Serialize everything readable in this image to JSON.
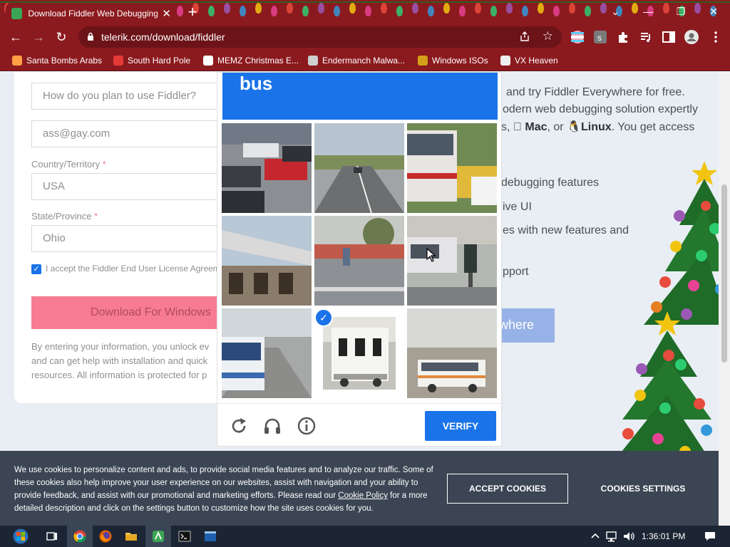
{
  "browser": {
    "tab_title": "Download Fiddler Web Debugging Proxy",
    "tab_close": "✕",
    "new_tab": "+",
    "url": "telerik.com/download/fiddler",
    "window_controls": [
      "⌄",
      "—",
      "❐",
      "✕"
    ],
    "nav": {
      "back": "←",
      "forward": "→",
      "reload": "↻"
    }
  },
  "bookmarks": [
    {
      "label": "Santa Bombs Arabs",
      "color": "#ff9f43"
    },
    {
      "label": "South Hard Pole",
      "color": "#e53935"
    },
    {
      "label": "MEMZ Christmas E...",
      "color": "#ffffff"
    },
    {
      "label": "Endermanch Malwa...",
      "color": "#cfcfcf"
    },
    {
      "label": "Windows ISOs",
      "color": "#d4a017"
    },
    {
      "label": "VX Heaven",
      "color": "#eeeeee"
    }
  ],
  "form": {
    "usage_placeholder": "How do you plan to use Fiddler?",
    "email_value": "ass@gay.com",
    "country_label": "Country/Territory",
    "country_value": "USA",
    "state_label": "State/Province",
    "state_value": "Ohio",
    "required_mark": "*",
    "eula_label": "I accept the Fiddler End User License Agreement",
    "download_button": "Download For Windows",
    "disclaimer": [
      "By entering your information, you unlock ev",
      "and can get help with installation and quick",
      "resources. All information is protected for p"
    ]
  },
  "promo": {
    "line1": "and try Fiddler Everywhere for free.",
    "line2": "odern web debugging solution expertly",
    "line3_pre": "s,",
    "mac": "Mac",
    "line3_mid": ", or",
    "linux": "Linux",
    "line3_post": ". You get access",
    "bullet1": "debugging features",
    "bullet2": "ive UI",
    "bullet3": "es with new features and",
    "bullet4": "pport",
    "button": "where"
  },
  "captcha": {
    "prompt_word": "bus",
    "tiles": [
      {
        "id": "tile-1",
        "selected": false
      },
      {
        "id": "tile-2",
        "selected": false
      },
      {
        "id": "tile-3",
        "selected": false
      },
      {
        "id": "tile-4",
        "selected": false
      },
      {
        "id": "tile-5",
        "selected": false
      },
      {
        "id": "tile-6",
        "selected": false
      },
      {
        "id": "tile-7",
        "selected": false
      },
      {
        "id": "tile-8",
        "selected": true
      },
      {
        "id": "tile-9",
        "selected": false
      }
    ],
    "verify_label": "VERIFY",
    "check_mark": "✓"
  },
  "cookie": {
    "text_before_link": "We use cookies to personalize content and ads, to provide social media features and to analyze our traffic. Some of these cookies also help improve your user experience on our websites, assist with navigation and your ability to provide feedback, and assist with our promotional and marketing efforts. Please read our ",
    "link": "Cookie Policy",
    "text_after_link": " for a more detailed description and click on the settings button to customize how the site uses cookies for you.",
    "accept_label": "ACCEPT COOKIES",
    "settings_label": "COOKIES SETTINGS"
  },
  "taskbar": {
    "clock": "1:36:01 PM"
  },
  "colors": {
    "chrome_theme": "#8b1a1f",
    "captcha_blue": "#1a73e8",
    "download_pink": "#f77b93"
  }
}
